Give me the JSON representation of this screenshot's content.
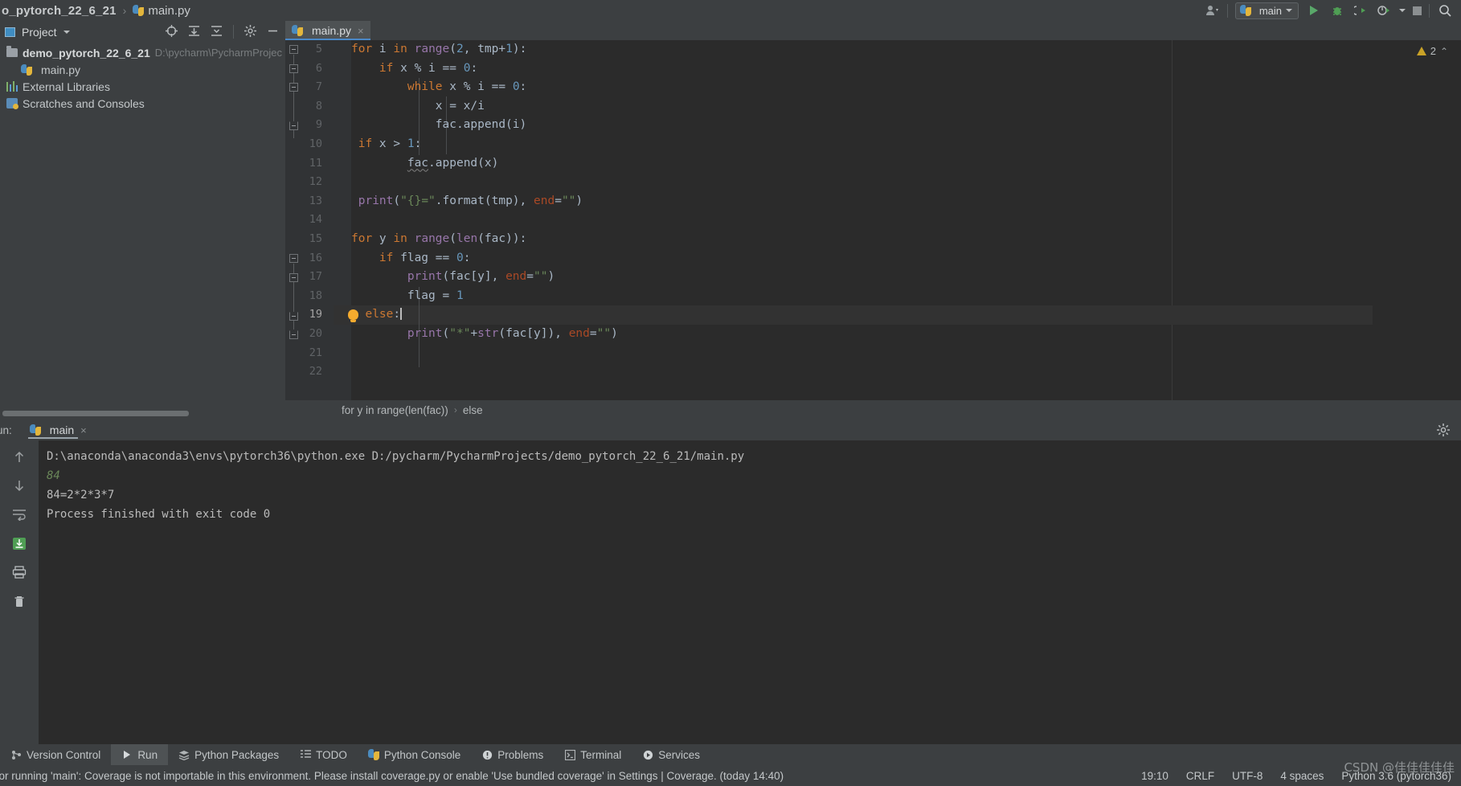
{
  "titlebar": {
    "project_crumb": "o_pytorch_22_6_21",
    "separator": "›",
    "file_crumb": "main.py",
    "run_config": "main",
    "icons": [
      "user-icon",
      "run-icon",
      "debug-icon",
      "run-coverage-icon",
      "profile-icon",
      "stop-icon",
      "search-icon"
    ]
  },
  "project_panel": {
    "title": "Project",
    "toolbar_icons": [
      "locate-icon",
      "expand-all-icon",
      "collapse-all-icon",
      "settings-icon",
      "hide-icon"
    ],
    "tree": [
      {
        "label": "demo_pytorch_22_6_21",
        "path": "D:\\pycharm\\PycharmProjec",
        "icon": "folder-icon",
        "level": 0,
        "bold": true
      },
      {
        "label": "main.py",
        "path": "",
        "icon": "python-file-icon",
        "level": 1,
        "bold": false
      },
      {
        "label": "External Libraries",
        "path": "",
        "icon": "libraries-icon",
        "level": 0,
        "bold": false
      },
      {
        "label": "Scratches and Consoles",
        "path": "",
        "icon": "scratches-icon",
        "level": 0,
        "bold": false
      }
    ]
  },
  "editor": {
    "tab": {
      "label": "main.py",
      "close": "×",
      "icon": "python-file-icon"
    },
    "inspection": {
      "count": "2",
      "icon": "warning-icon",
      "chevron": "⌃"
    },
    "breadcrumb": [
      "for y in range(len(fac))",
      "else"
    ],
    "breadcrumb_sep": "›",
    "caret_line": 19,
    "lines": [
      {
        "no": "5",
        "text": "for i in range(2, tmp+1):"
      },
      {
        "no": "6",
        "text": "    if x % i == 0:"
      },
      {
        "no": "7",
        "text": "        while x % i == 0:"
      },
      {
        "no": "8",
        "text": "            x = x/i"
      },
      {
        "no": "9",
        "text": "            fac.append(i)"
      },
      {
        "no": "10",
        "text": "if x > 1:"
      },
      {
        "no": "11",
        "text": "        fac.append(x)"
      },
      {
        "no": "12",
        "text": ""
      },
      {
        "no": "13",
        "text": "print(\"{}=\".format(tmp), end=\"\")"
      },
      {
        "no": "14",
        "text": ""
      },
      {
        "no": "15",
        "text": "for y in range(len(fac)):"
      },
      {
        "no": "16",
        "text": "    if flag == 0:"
      },
      {
        "no": "17",
        "text": "        print(fac[y], end=\"\")"
      },
      {
        "no": "18",
        "text": "        flag = 1"
      },
      {
        "no": "19",
        "text": "    else:"
      },
      {
        "no": "20",
        "text": "        print(\"*\"+str(fac[y]), end=\"\")"
      },
      {
        "no": "21",
        "text": ""
      },
      {
        "no": "22",
        "text": ""
      }
    ]
  },
  "run_panel": {
    "label": "un:",
    "tab": "main",
    "tab_close": "×",
    "gear": "⚙",
    "sidebar_icons": [
      "up-arrow-icon",
      "down-arrow-icon",
      "soft-wrap-icon",
      "scroll-to-end-icon",
      "print-icon",
      "trash-icon"
    ],
    "console": [
      {
        "text": "D:\\anaconda\\anaconda3\\envs\\pytorch36\\python.exe D:/pycharm/PycharmProjects/demo_pytorch_22_6_21/main.py",
        "style": "normal"
      },
      {
        "text": "84",
        "style": "green"
      },
      {
        "text": "84=2*2*3*7",
        "style": "normal"
      },
      {
        "text": "Process finished with exit code 0",
        "style": "normal"
      }
    ]
  },
  "bottom_toolbar": [
    {
      "label": "Version Control",
      "icon": "branch-icon",
      "active": false
    },
    {
      "label": "Run",
      "icon": "play-icon",
      "active": true
    },
    {
      "label": "Python Packages",
      "icon": "packages-icon",
      "active": false
    },
    {
      "label": "TODO",
      "icon": "list-icon",
      "active": false
    },
    {
      "label": "Python Console",
      "icon": "python-icon",
      "active": false
    },
    {
      "label": "Problems",
      "icon": "problems-icon",
      "active": false
    },
    {
      "label": "Terminal",
      "icon": "terminal-icon",
      "active": false
    },
    {
      "label": "Services",
      "icon": "services-icon",
      "active": false
    }
  ],
  "statusbar": {
    "message": "ror running 'main': Coverage is not importable in this environment. Please install coverage.py or enable 'Use bundled coverage' in Settings | Coverage. (today 14:40)",
    "position": "19:10",
    "line_sep": "CRLF",
    "encoding": "UTF-8",
    "indent": "4 spaces",
    "interpreter": "Python 3.6 (pytorch36)"
  },
  "watermark": "CSDN @佳佳佳佳佳",
  "colors": {
    "bg_panel": "#3c3f41",
    "bg_editor": "#2b2b2b",
    "accent_blue": "#4a88c7",
    "keyword": "#cc7832",
    "string": "#6a8759",
    "number": "#6897bb",
    "text": "#a9b7c6"
  }
}
